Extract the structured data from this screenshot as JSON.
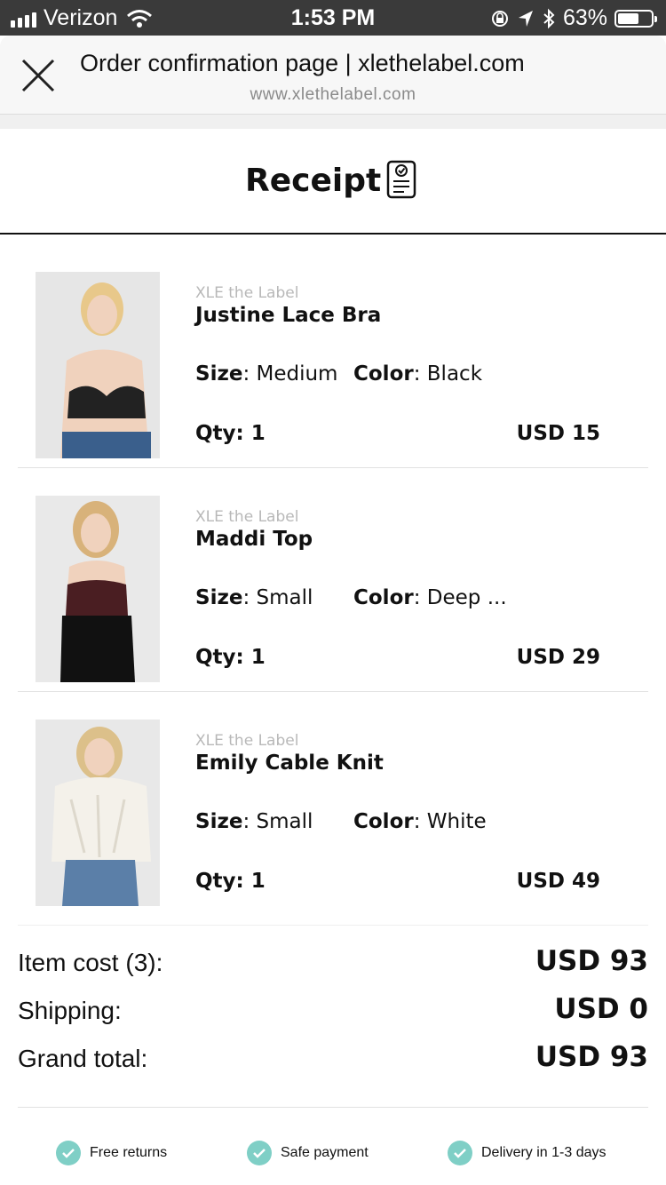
{
  "status_bar": {
    "carrier": "Verizon",
    "time": "1:53 PM",
    "battery": "63%",
    "battery_level": 0.63
  },
  "browser": {
    "title": "Order confirmation page | xlethelabel.com",
    "url": "www.xlethelabel.com"
  },
  "receipt": {
    "title": "Receipt"
  },
  "labels": {
    "size": "Size",
    "color": "Color",
    "qty": "Qty:"
  },
  "items": [
    {
      "brand": "XLE the Label",
      "name": "Justine Lace Bra",
      "size": "Medium",
      "color": "Black",
      "qty": "1",
      "price": "USD 15"
    },
    {
      "brand": "XLE the Label",
      "name": "Maddi Top",
      "size": "Small",
      "color": "Deep ...",
      "qty": "1",
      "price": "USD 29"
    },
    {
      "brand": "XLE the Label",
      "name": "Emily Cable Knit",
      "size": "Small",
      "color": "White",
      "qty": "1",
      "price": "USD 49"
    }
  ],
  "totals": [
    {
      "label": "Item cost (3):",
      "value": "USD 93"
    },
    {
      "label": "Shipping:",
      "value": "USD 0"
    },
    {
      "label": "Grand total:",
      "value": "USD 93"
    }
  ],
  "features": [
    "Free returns",
    "Safe payment",
    "Delivery in 1-3 days"
  ],
  "colors": {
    "accent": "#7fcfc6",
    "status_bar": "#3a3a3a"
  }
}
